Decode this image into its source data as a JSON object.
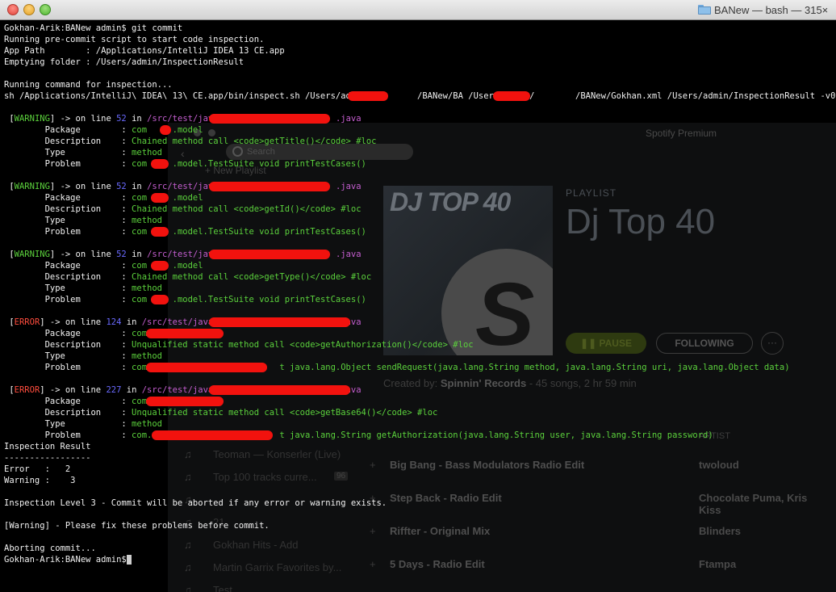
{
  "window": {
    "title": "BANew — bash — 315×",
    "traffic_lights": [
      "close",
      "minimize",
      "zoom"
    ],
    "folder_icon": "folder-icon"
  },
  "terminal": {
    "lines": [
      {
        "segs": [
          {
            "t": "Gokhan-Arik:BANew admin$ git commit",
            "c": "b"
          }
        ]
      },
      {
        "segs": [
          {
            "t": "Running pre-commit script to start code inspection.",
            "c": "b"
          }
        ]
      },
      {
        "segs": [
          {
            "t": "App Path        : /Applications/IntelliJ IDEA 13 CE.app",
            "c": "b"
          }
        ]
      },
      {
        "segs": [
          {
            "t": "Emptying folder : /Users/admin/InspectionResult",
            "c": "b"
          }
        ]
      },
      {
        "segs": []
      },
      {
        "segs": [
          {
            "t": "Running command for inspection...",
            "c": "b"
          }
        ]
      },
      {
        "segs": [
          {
            "t": "sh /Applications/IntelliJ\\ IDEA\\ 13\\ CE.app/bin/inspect.sh /Users/admin          /BANew/BA /Users/admin/        /BANew/Gokhan.xml /Users/admin/InspectionResult -v0",
            "c": "b"
          }
        ]
      },
      {
        "segs": []
      },
      {
        "segs": [
          {
            "t": " [",
            "c": "b"
          },
          {
            "t": "WARNING",
            "c": "w"
          },
          {
            "t": "] -> on line ",
            "c": "b"
          },
          {
            "t": "52",
            "c": "n"
          },
          {
            "t": " in ",
            "c": "b"
          },
          {
            "t": "/src/test/java/                      .java",
            "c": "p"
          }
        ]
      },
      {
        "segs": [
          {
            "t": "        Package        : ",
            "c": "b"
          },
          {
            "t": "com     .model",
            "c": "g"
          }
        ]
      },
      {
        "segs": [
          {
            "t": "        Description    : ",
            "c": "b"
          },
          {
            "t": "Chained method call <code>getTitle()</code> #loc",
            "c": "g"
          }
        ]
      },
      {
        "segs": [
          {
            "t": "        Type           : ",
            "c": "b"
          },
          {
            "t": "method",
            "c": "g"
          }
        ]
      },
      {
        "segs": [
          {
            "t": "        Problem        : ",
            "c": "b"
          },
          {
            "t": "com     .model.TestSuite void printTestCases()",
            "c": "g"
          }
        ]
      },
      {
        "segs": []
      },
      {
        "segs": [
          {
            "t": " [",
            "c": "b"
          },
          {
            "t": "WARNING",
            "c": "w"
          },
          {
            "t": "] -> on line ",
            "c": "b"
          },
          {
            "t": "52",
            "c": "n"
          },
          {
            "t": " in ",
            "c": "b"
          },
          {
            "t": "/src/test/java/                      .java",
            "c": "p"
          }
        ]
      },
      {
        "segs": [
          {
            "t": "        Package        : ",
            "c": "b"
          },
          {
            "t": "com     .model",
            "c": "g"
          }
        ]
      },
      {
        "segs": [
          {
            "t": "        Description    : ",
            "c": "b"
          },
          {
            "t": "Chained method call <code>getId()</code> #loc",
            "c": "g"
          }
        ]
      },
      {
        "segs": [
          {
            "t": "        Type           : ",
            "c": "b"
          },
          {
            "t": "method",
            "c": "g"
          }
        ]
      },
      {
        "segs": [
          {
            "t": "        Problem        : ",
            "c": "b"
          },
          {
            "t": "com     .model.TestSuite void printTestCases()",
            "c": "g"
          }
        ]
      },
      {
        "segs": []
      },
      {
        "segs": [
          {
            "t": " [",
            "c": "b"
          },
          {
            "t": "WARNING",
            "c": "w"
          },
          {
            "t": "] -> on line ",
            "c": "b"
          },
          {
            "t": "52",
            "c": "n"
          },
          {
            "t": " in ",
            "c": "b"
          },
          {
            "t": "/src/test/java/                      .java",
            "c": "p"
          }
        ]
      },
      {
        "segs": [
          {
            "t": "        Package        : ",
            "c": "b"
          },
          {
            "t": "com     .model",
            "c": "g"
          }
        ]
      },
      {
        "segs": [
          {
            "t": "        Description    : ",
            "c": "b"
          },
          {
            "t": "Chained method call <code>getType()</code> #loc",
            "c": "g"
          }
        ]
      },
      {
        "segs": [
          {
            "t": "        Type           : ",
            "c": "b"
          },
          {
            "t": "method",
            "c": "g"
          }
        ]
      },
      {
        "segs": [
          {
            "t": "        Problem        : ",
            "c": "b"
          },
          {
            "t": "com     .model.TestSuite void printTestCases()",
            "c": "g"
          }
        ]
      },
      {
        "segs": []
      },
      {
        "segs": [
          {
            "t": " [",
            "c": "b"
          },
          {
            "t": "ERROR",
            "c": "e"
          },
          {
            "t": "] -> on line ",
            "c": "b"
          },
          {
            "t": "124",
            "c": "n"
          },
          {
            "t": " in ",
            "c": "b"
          },
          {
            "t": "/src/test/java/                       .java",
            "c": "p"
          }
        ]
      },
      {
        "segs": [
          {
            "t": "        Package        : ",
            "c": "b"
          },
          {
            "t": "com",
            "c": "g"
          }
        ]
      },
      {
        "segs": [
          {
            "t": "        Description    : ",
            "c": "b"
          },
          {
            "t": "Unqualified static method call <code>getAuthorization()</code> #loc",
            "c": "g"
          }
        ]
      },
      {
        "segs": [
          {
            "t": "        Type           : ",
            "c": "b"
          },
          {
            "t": "method",
            "c": "g"
          }
        ]
      },
      {
        "segs": [
          {
            "t": "        Problem        : ",
            "c": "b"
          },
          {
            "t": "com                          t java.lang.Object sendRequest(java.lang.String method, java.lang.String uri, java.lang.Object data)",
            "c": "g"
          }
        ]
      },
      {
        "segs": []
      },
      {
        "segs": [
          {
            "t": " [",
            "c": "b"
          },
          {
            "t": "ERROR",
            "c": "e"
          },
          {
            "t": "] -> on line ",
            "c": "b"
          },
          {
            "t": "227",
            "c": "n"
          },
          {
            "t": " in ",
            "c": "b"
          },
          {
            "t": "/src/test/java/                       .java",
            "c": "p"
          }
        ]
      },
      {
        "segs": [
          {
            "t": "        Package        : ",
            "c": "b"
          },
          {
            "t": "com",
            "c": "g"
          }
        ]
      },
      {
        "segs": [
          {
            "t": "        Description    : ",
            "c": "b"
          },
          {
            "t": "Unqualified static method call <code>getBase64()</code> #loc",
            "c": "g"
          }
        ]
      },
      {
        "segs": [
          {
            "t": "        Type           : ",
            "c": "b"
          },
          {
            "t": "method",
            "c": "g"
          }
        ]
      },
      {
        "segs": [
          {
            "t": "        Problem        : ",
            "c": "b"
          },
          {
            "t": "com.                         t java.lang.String getAuthorization(java.lang.String user, java.lang.String password)",
            "c": "g"
          }
        ]
      },
      {
        "segs": [
          {
            "t": "Inspection Result",
            "c": "b"
          }
        ]
      },
      {
        "segs": [
          {
            "t": "-----------------",
            "c": "b"
          }
        ]
      },
      {
        "segs": [
          {
            "t": "Error   :   2",
            "c": "b"
          }
        ]
      },
      {
        "segs": [
          {
            "t": "Warning :    3",
            "c": "b"
          }
        ]
      },
      {
        "segs": []
      },
      {
        "segs": [
          {
            "t": "Inspection Level 3 - Commit will be aborted if any error or warning exists.",
            "c": "b"
          }
        ]
      },
      {
        "segs": []
      },
      {
        "segs": [
          {
            "t": "[Warning] - Please fix these problems before commit.",
            "c": "b"
          }
        ]
      },
      {
        "segs": []
      },
      {
        "segs": [
          {
            "t": "Aborting commit...",
            "c": "b"
          }
        ]
      },
      {
        "segs": [
          {
            "t": "Gokhan-Arik:BANew admin$ ",
            "c": "b"
          }
        ]
      }
    ]
  },
  "background_app": {
    "app_title": "Spotify Premium",
    "search_placeholder": "Search",
    "new_playlist": "+ New Playlist",
    "cover_text": "DJ TOP 40",
    "playlist_label": "PLAYLIST",
    "playlist_title": "Dj Top 40",
    "pause_label": "PAUSE",
    "following_label": "FOLLOWING",
    "more_label": "···",
    "created_prefix": "Created by: ",
    "created_by": "Spinnin' Records",
    "created_suffix": " - 45 songs, 2 hr 59 min",
    "artist_header": "ARTIST",
    "tracks": [
      {
        "name": "Big Bang - Bass Modulators Radio Edit",
        "artist": "twoloud"
      },
      {
        "name": "Step Back - Radio Edit",
        "artist": "Chocolate Puma, Kris Kiss"
      },
      {
        "name": "Riffter - Original Mix",
        "artist": "Blinders"
      },
      {
        "name": "5 Days - Radio Edit",
        "artist": "Ftampa"
      }
    ],
    "sidebar": [
      {
        "name": "Teoman — Konserler (Live)",
        "count": ""
      },
      {
        "name": "Top 100 tracks curre...",
        "count": "96"
      },
      {
        "name": "",
        "count": ""
      },
      {
        "name": "21",
        "count": ""
      },
      {
        "name": "Gokhan Hits - Add",
        "count": ""
      },
      {
        "name": "Martin Garrix Favorites by...",
        "count": ""
      },
      {
        "name": "Test",
        "count": ""
      }
    ]
  }
}
